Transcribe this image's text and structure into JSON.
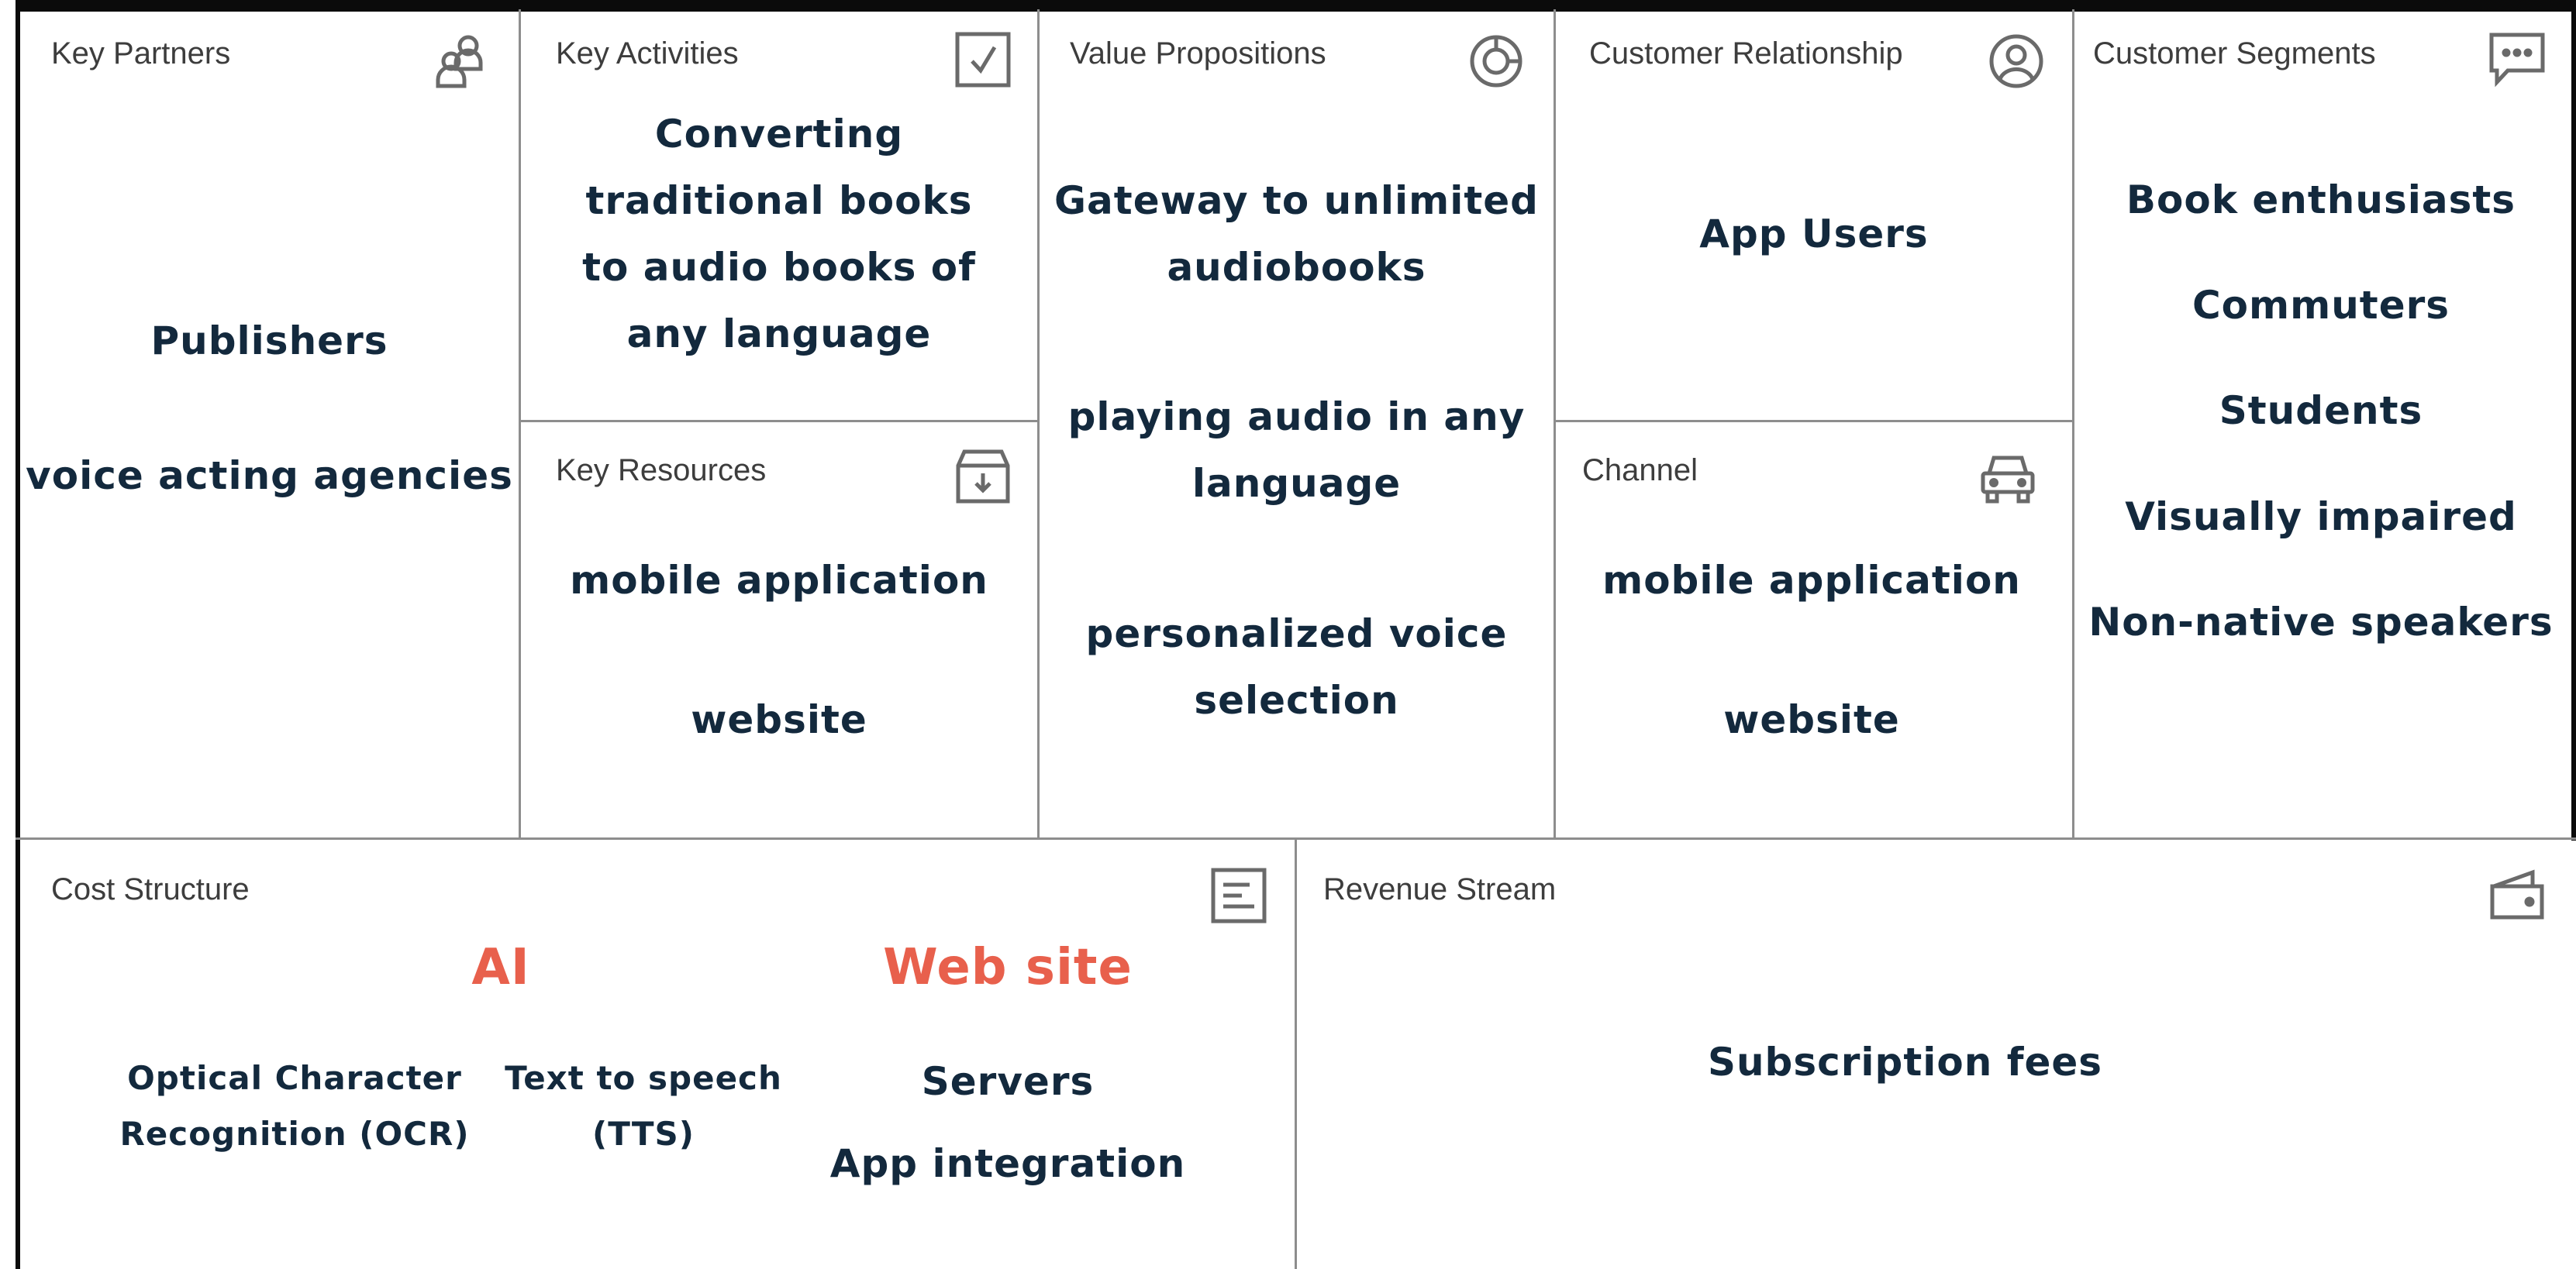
{
  "colors": {
    "frame": "#0b0b0b",
    "divider": "#8d8d8d",
    "heading_text": "#3d3d3d",
    "body_text": "#13293d",
    "accent": "#e8604c"
  },
  "key_partners": {
    "title": "Key Partners",
    "icon": "people-icon",
    "items": [
      "Publishers",
      "voice acting agencies"
    ]
  },
  "key_activities": {
    "title": "Key Activities",
    "icon": "checkbox-icon",
    "lines": [
      "Converting",
      "traditional books",
      "to audio books of",
      "any language"
    ]
  },
  "key_resources": {
    "title": "Key Resources",
    "icon": "archive-box-icon",
    "items": [
      "mobile application",
      "website"
    ]
  },
  "value_propositions": {
    "title": "Value Propositions",
    "icon": "pie-chart-icon",
    "items": [
      {
        "line1": "Gateway to unlimited",
        "line2": "audiobooks"
      },
      {
        "line1": "playing audio in any",
        "line2": "language"
      },
      {
        "line1": "personalized voice",
        "line2": "selection"
      }
    ]
  },
  "customer_relationship": {
    "title": "Customer Relationship",
    "icon": "user-circle-icon",
    "items": [
      "App Users"
    ]
  },
  "channel": {
    "title": "Channel",
    "icon": "car-icon",
    "items": [
      "mobile application",
      "website"
    ]
  },
  "customer_segments": {
    "title": "Customer Segments",
    "icon": "chat-bubble-icon",
    "items": [
      "Book enthusiasts",
      "Commuters",
      "Students",
      "Visually impaired",
      "Non-native speakers"
    ]
  },
  "cost_structure": {
    "title": "Cost Structure",
    "icon": "document-lines-icon",
    "groups": [
      {
        "heading": "AI",
        "items": [
          {
            "line1": "Optical Character",
            "line2": "Recognition (OCR)"
          },
          {
            "line1": "Text to speech",
            "line2": "(TTS)"
          }
        ]
      },
      {
        "heading": "Web site",
        "items": [
          "Servers",
          "App integration"
        ]
      }
    ]
  },
  "revenue_stream": {
    "title": "Revenue Stream",
    "icon": "wallet-icon",
    "items": [
      "Subscription fees"
    ]
  }
}
